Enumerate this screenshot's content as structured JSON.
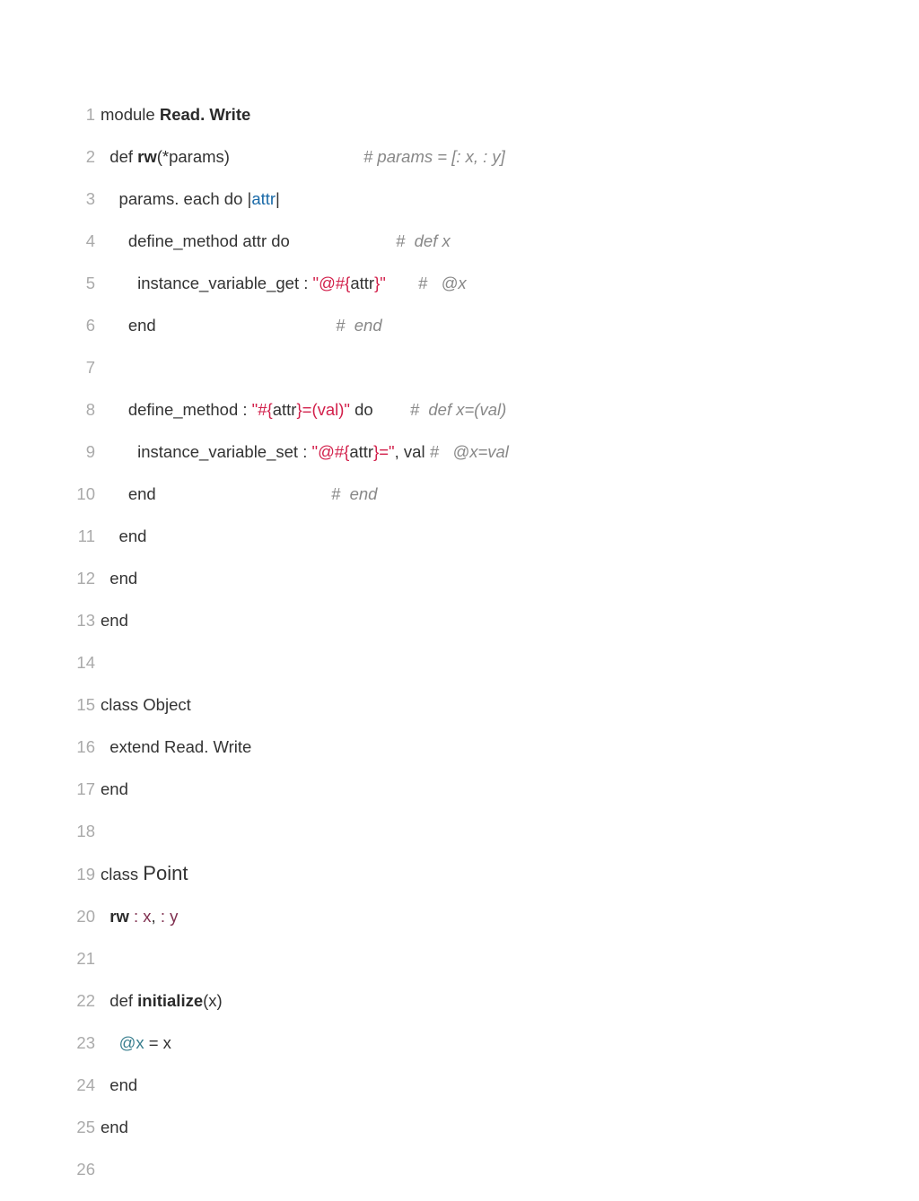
{
  "code": {
    "lineno": [
      "1",
      "2",
      "3",
      "4",
      "5",
      "6",
      "7",
      "8",
      "9",
      "10",
      "11",
      "12",
      "13",
      "14",
      "15",
      "16",
      "17",
      "18",
      "19",
      "20",
      "21",
      "22",
      "23",
      "24",
      "25",
      "26"
    ],
    "l1": {
      "a": "module ",
      "b": "Read. Write"
    },
    "l2": {
      "a": "  def ",
      "b": "rw",
      "c": "(*params)                             ",
      "d": "# params = [: x, : y]"
    },
    "l3": {
      "a": "    params. each do |",
      "b": "attr",
      "c": "|"
    },
    "l4": {
      "a": "      define_method attr do                       ",
      "b": "#  def x"
    },
    "l5": {
      "a": "        instance_variable_get : ",
      "b": "\"@#",
      "c": "{",
      "d": "attr",
      "e": "}",
      "f": "\"",
      "g": "       ",
      "h": "#   @x"
    },
    "l6": {
      "a": "      end                                       ",
      "b": "#  end"
    },
    "l8": {
      "a": "      define_method : ",
      "b": "\"#",
      "c": "{",
      "d": "attr",
      "e": "}",
      "f": "=(val)\"",
      "g": " do        ",
      "h": "#  def x=(val)"
    },
    "l9": {
      "a": "        instance_variable_set : ",
      "b": "\"@#",
      "c": "{",
      "d": "attr",
      "e": "}",
      "f": "=\"",
      "g": ", val ",
      "h": "#   @x=val"
    },
    "l10": {
      "a": "      end                                      ",
      "b": "#  end"
    },
    "l11": {
      "a": "    end"
    },
    "l12": {
      "a": "  end"
    },
    "l13": {
      "a": "end"
    },
    "l15": {
      "a": "class ",
      "b": "Object"
    },
    "l16": {
      "a": "  extend Read. Write"
    },
    "l17": {
      "a": "end"
    },
    "l19": {
      "a": "class ",
      "b": "Point"
    },
    "l20": {
      "a": "  ",
      "b": "rw ",
      "c": ": x",
      "d": ", ",
      "e": ": y"
    },
    "l22": {
      "a": "  def ",
      "b": "initialize",
      "c": "(x)"
    },
    "l23": {
      "a": "    ",
      "b": "@x",
      "c": " = x"
    },
    "l24": {
      "a": "  end"
    },
    "l25": {
      "a": "end"
    }
  }
}
